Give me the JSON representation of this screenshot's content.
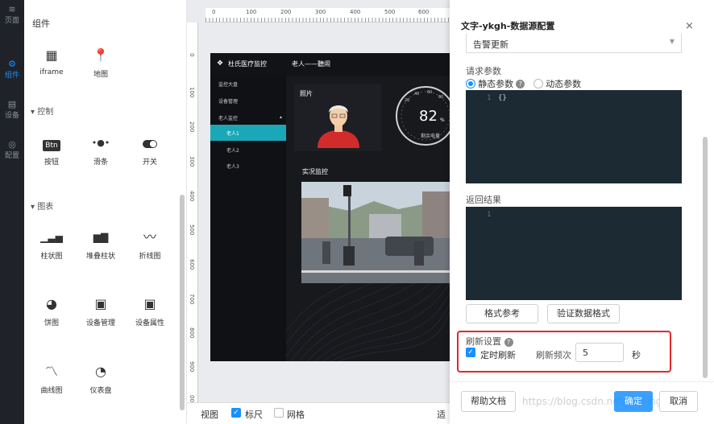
{
  "nav": {
    "items": [
      {
        "icon": "≋",
        "label": "页面"
      },
      {
        "icon": "⚙",
        "label": "组件"
      },
      {
        "icon": "▤",
        "label": "设备"
      },
      {
        "icon": "◎",
        "label": "配置"
      }
    ]
  },
  "components": {
    "title": "组件",
    "top_items": [
      {
        "glyph": "▦",
        "label": "iframe",
        "icon": "iframe-icon"
      },
      {
        "glyph": "📍",
        "label": "地图",
        "icon": "map-pin-icon"
      }
    ],
    "group_control": "▾ 控制",
    "control_items": [
      {
        "glyph": "Btn",
        "label": "按钮",
        "icon": "button-icon"
      },
      {
        "glyph": "•●•",
        "label": "滑条",
        "icon": "slider-icon"
      },
      {
        "glyph": "⬤",
        "label": "开关",
        "icon": "switch-icon"
      }
    ],
    "group_chart": "▾ 图表",
    "chart_items": [
      {
        "glyph": "▁▃▅",
        "label": "柱状图",
        "icon": "bar-chart-icon"
      },
      {
        "glyph": "▆▇",
        "label": "堆叠柱状",
        "icon": "stacked-bar-icon"
      },
      {
        "glyph": "〰",
        "label": "折线图",
        "icon": "line-chart-icon"
      },
      {
        "glyph": "◕",
        "label": "饼图",
        "icon": "pie-chart-icon"
      },
      {
        "glyph": "▣",
        "label": "设备管理",
        "icon": "device-manage-icon"
      },
      {
        "glyph": "▣",
        "label": "设备属性",
        "icon": "device-attr-icon"
      },
      {
        "glyph": "〽",
        "label": "曲线图",
        "icon": "curve-chart-icon"
      },
      {
        "glyph": "◔",
        "label": "仪表盘",
        "icon": "gauge-icon"
      }
    ]
  },
  "ruler": {
    "top": [
      "0",
      "100",
      "200",
      "300",
      "400",
      "500",
      "600"
    ],
    "left": [
      "0",
      "100",
      "200",
      "300",
      "400",
      "500",
      "600",
      "700",
      "800",
      "900",
      "00"
    ]
  },
  "dashboard": {
    "brand": "杜氏医疗监控",
    "header_title": "老人——聽闹",
    "menu": [
      "监控大盘",
      "设备管理",
      "老人监控"
    ],
    "submenu": [
      "老人1",
      "老人2",
      "老人3"
    ],
    "photo_title": "照片",
    "gauge_value": "82",
    "gauge_unit": "%",
    "gauge_caption": "剩余电量",
    "gauge_ticks": [
      "20",
      "40",
      "60",
      "80"
    ],
    "live_title": "实况监控"
  },
  "bottom": {
    "view": "视图",
    "ruler": "标尺",
    "grid": "网格",
    "fit": "适"
  },
  "panel": {
    "title": "文字-ykgh-数据源配置",
    "close": "×",
    "select_value": "告警更新",
    "request_label": "请求参数",
    "static_param": "静态参数",
    "dynamic_param": "动态参数",
    "code_line": "1",
    "code_text": "{}",
    "result_label": "返回结果",
    "result_line": "1",
    "format_ref": "格式参考",
    "verify_format": "验证数据格式",
    "refresh_settings": "刷新设置",
    "timed_refresh": "定时刷新",
    "refresh_freq": "刷新频次",
    "freq_value": "5",
    "seconds": "秒",
    "help_doc": "帮助文档",
    "confirm": "确定",
    "cancel": "取消",
    "watermark": "https://blog.csdn.net/yumingsight"
  },
  "colors": {
    "accent": "#1890ff",
    "teal": "#1aa8b8",
    "highlight": "#e0292a",
    "nav_bg": "#1f2329"
  }
}
